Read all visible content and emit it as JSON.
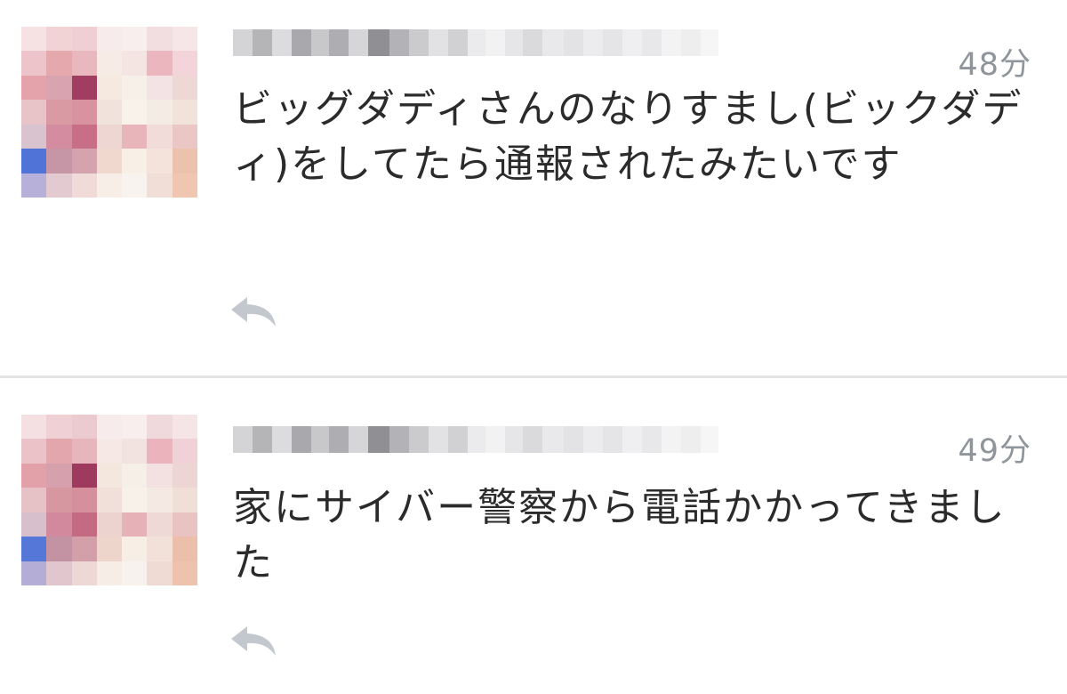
{
  "tweets": [
    {
      "time": "48分",
      "text": "ビッグダディさんのなりすまし(ビックダディ)をしてたら通報されたみたいです",
      "reply_icon": "reply-arrow-icon"
    },
    {
      "time": "49分",
      "text": "家にサイバー警察から電話かかってきました",
      "reply_icon": "reply-arrow-icon"
    }
  ],
  "colors": {
    "text": "#2b2b2b",
    "timestamp": "#8f959b",
    "reply_icon": "#c3c8ce",
    "separator": "#e3e3e6"
  }
}
